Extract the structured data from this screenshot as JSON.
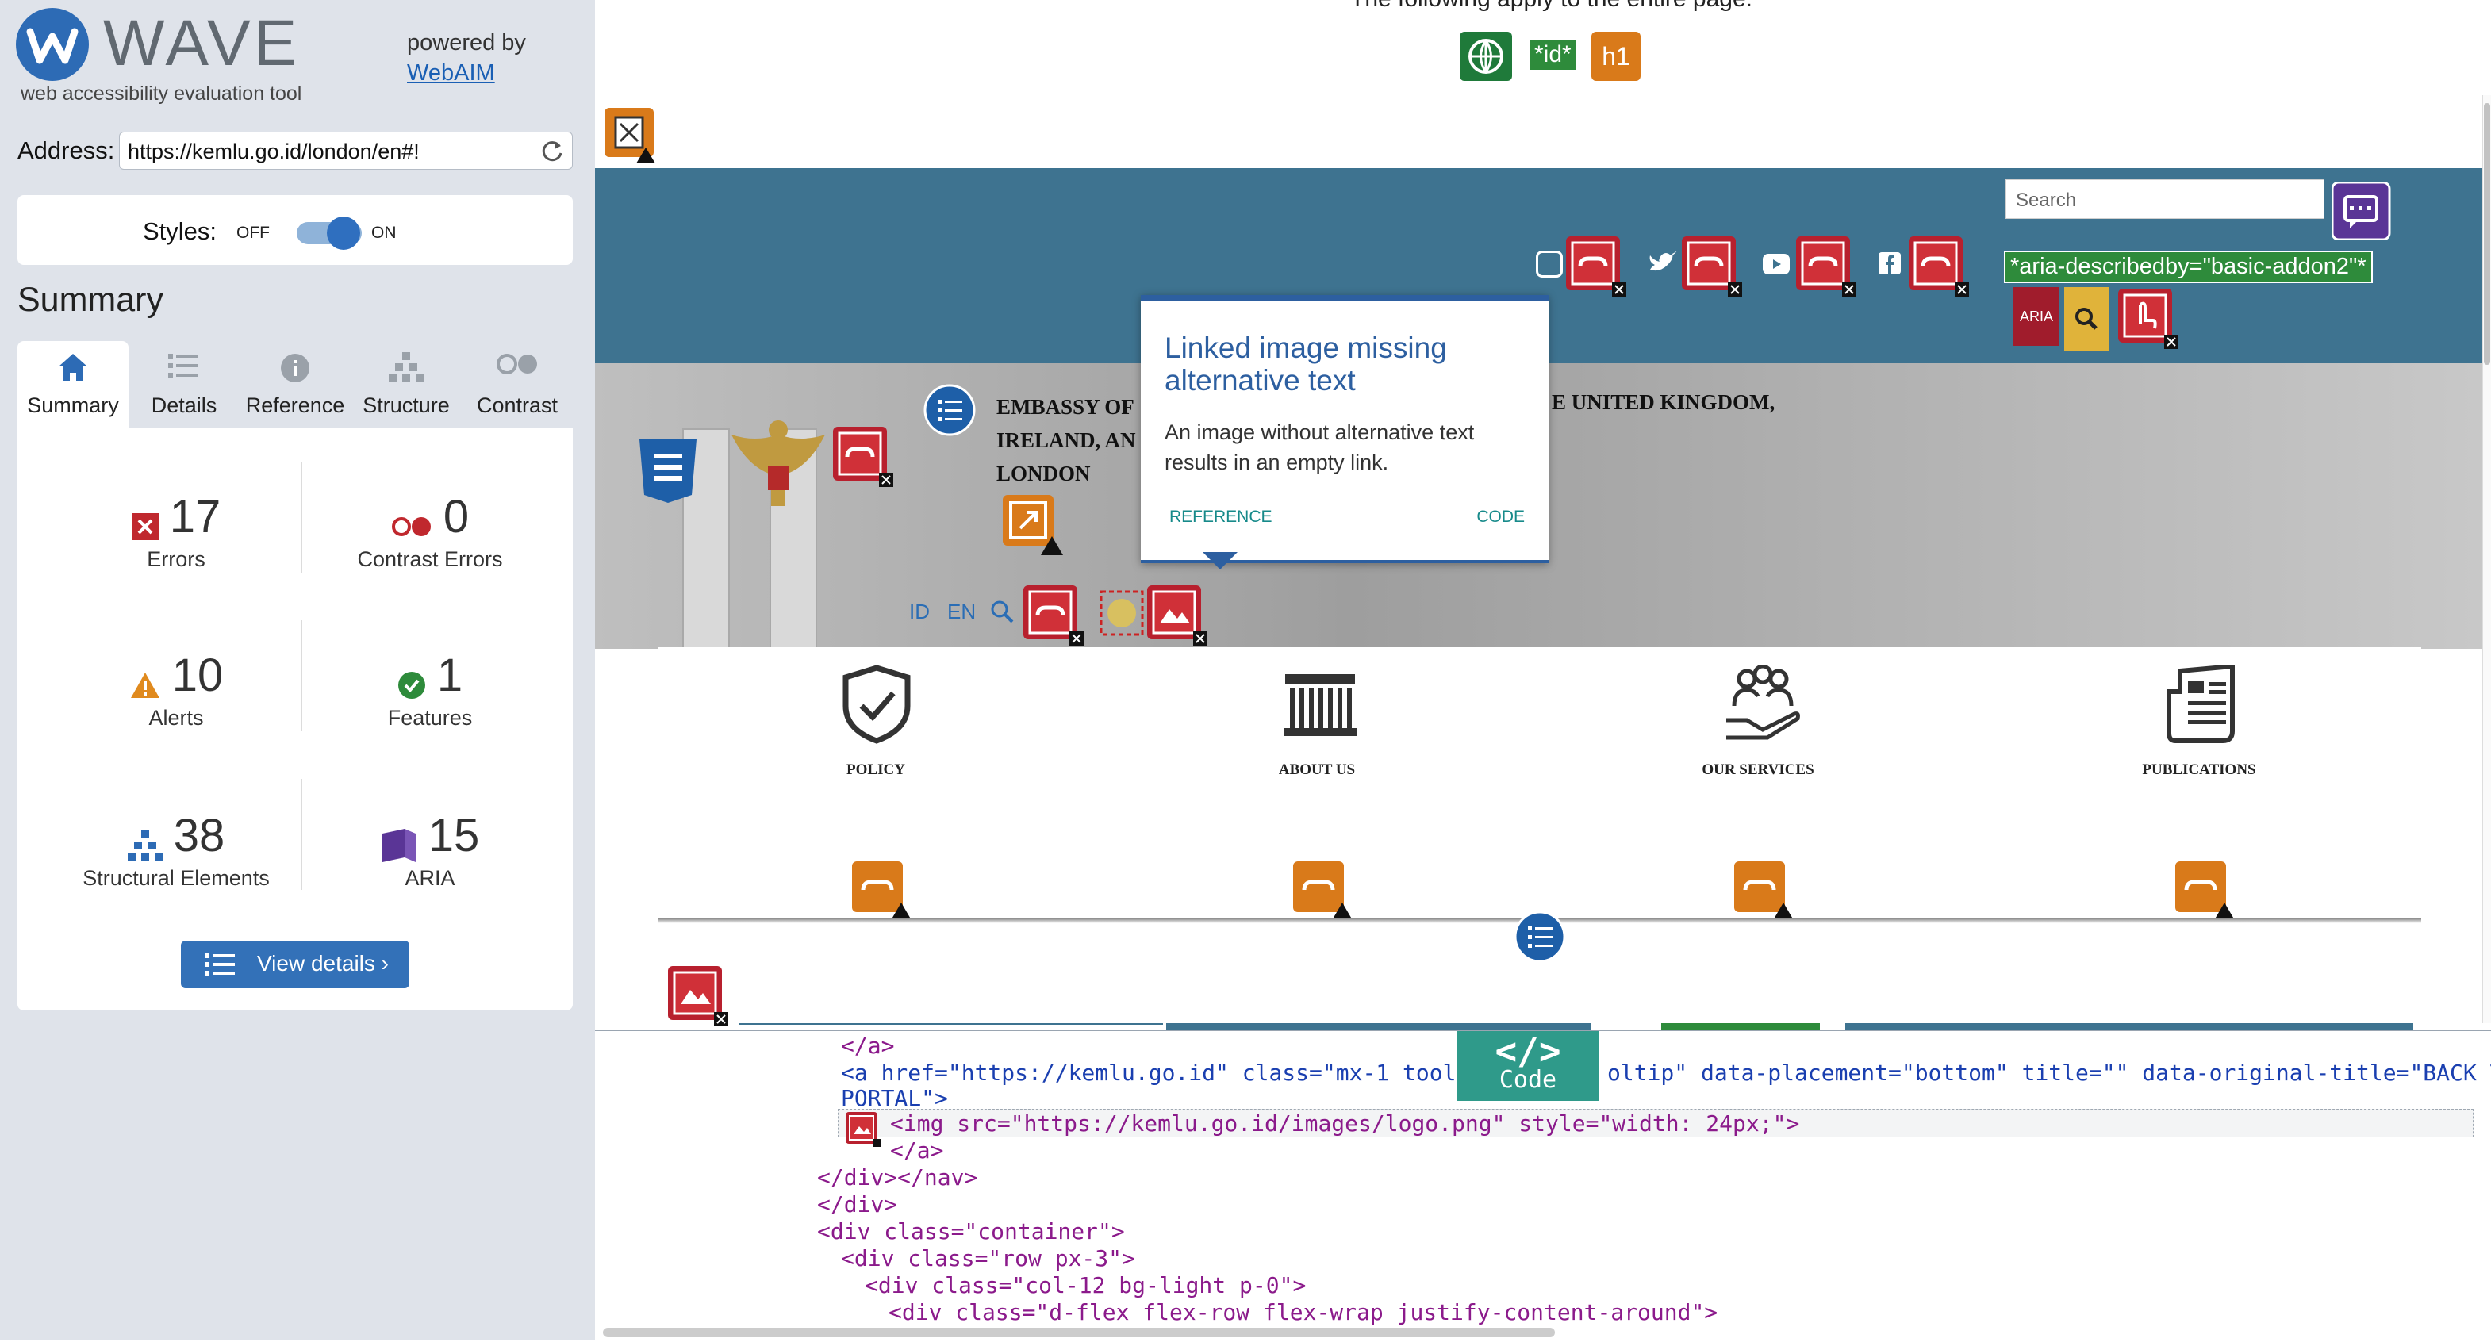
{
  "sidebar": {
    "logo_text": "WAVE",
    "tagline": "web accessibility evaluation tool",
    "powered_by": "powered by",
    "webaim_link": "WebAIM",
    "address_label": "Address:",
    "address_value": "https://kemlu.go.id/london/en#!",
    "styles_label": "Styles:",
    "styles_off": "OFF",
    "styles_on": "ON",
    "summary_heading": "Summary",
    "tabs": [
      {
        "label": "Summary",
        "icon": "home-icon"
      },
      {
        "label": "Details",
        "icon": "list-icon"
      },
      {
        "label": "Reference",
        "icon": "info-icon"
      },
      {
        "label": "Structure",
        "icon": "hierarchy-icon"
      },
      {
        "label": "Contrast",
        "icon": "contrast-icon"
      }
    ],
    "stats": {
      "errors": {
        "value": "17",
        "label": "Errors"
      },
      "contrast_errors": {
        "value": "0",
        "label": "Contrast Errors"
      },
      "alerts": {
        "value": "10",
        "label": "Alerts"
      },
      "features": {
        "value": "1",
        "label": "Features"
      },
      "structural": {
        "value": "38",
        "label": "Structural Elements"
      },
      "aria": {
        "value": "15",
        "label": "ARIA"
      }
    },
    "view_details": "View details ›"
  },
  "main": {
    "top_note": "The following apply to the entire page.",
    "page_badges": {
      "id": "*id*",
      "h1": "h1"
    },
    "search_placeholder": "Search",
    "aria_describedby": "*aria-describedby=\"basic-addon2\"*",
    "aria_badge": "ARIA",
    "embassy_left": [
      "EMBASSY OF",
      "IRELAND, AN",
      "LONDON"
    ],
    "embassy_right": "E UNITED KINGDOM,",
    "lang": [
      "ID",
      "EN"
    ],
    "cards": [
      "POLICY",
      "ABOUT US",
      "OUR SERVICES",
      "PUBLICATIONS"
    ],
    "tooltip": {
      "title": "Linked image missing alternative text",
      "text": "An image without alternative text results in an empty link.",
      "reference": "REFERENCE",
      "code": "CODE"
    }
  },
  "code_panel": {
    "tab_icon": "</>",
    "tab_label": "Code",
    "lines": [
      "</a>",
      "<a href=\"https://kemlu.go.id\" class=\"mx-1 tooltips\" dat",
      "oltip\" data-placement=\"bottom\" title=\"\" data-original-title=\"BACK TO MAIN",
      "PORTAL\">",
      "<img src=\"https://kemlu.go.id/images/logo.png\" style=\"width: 24px;\">",
      "</a>",
      "</div></nav>",
      "</div>",
      "<div class=\"container\">",
      "<div class=\"row px-3\">",
      "<div class=\"col-12 bg-light p-0\">",
      "<div class=\"d-flex flex-row flex-wrap justify-content-around\">"
    ]
  },
  "colors": {
    "wave_blue": "#2d6bb5",
    "error_red": "#b8202e",
    "alert_orange": "#d97a1a",
    "header_teal": "#3e7390",
    "code_tab": "#2f9a8a"
  }
}
